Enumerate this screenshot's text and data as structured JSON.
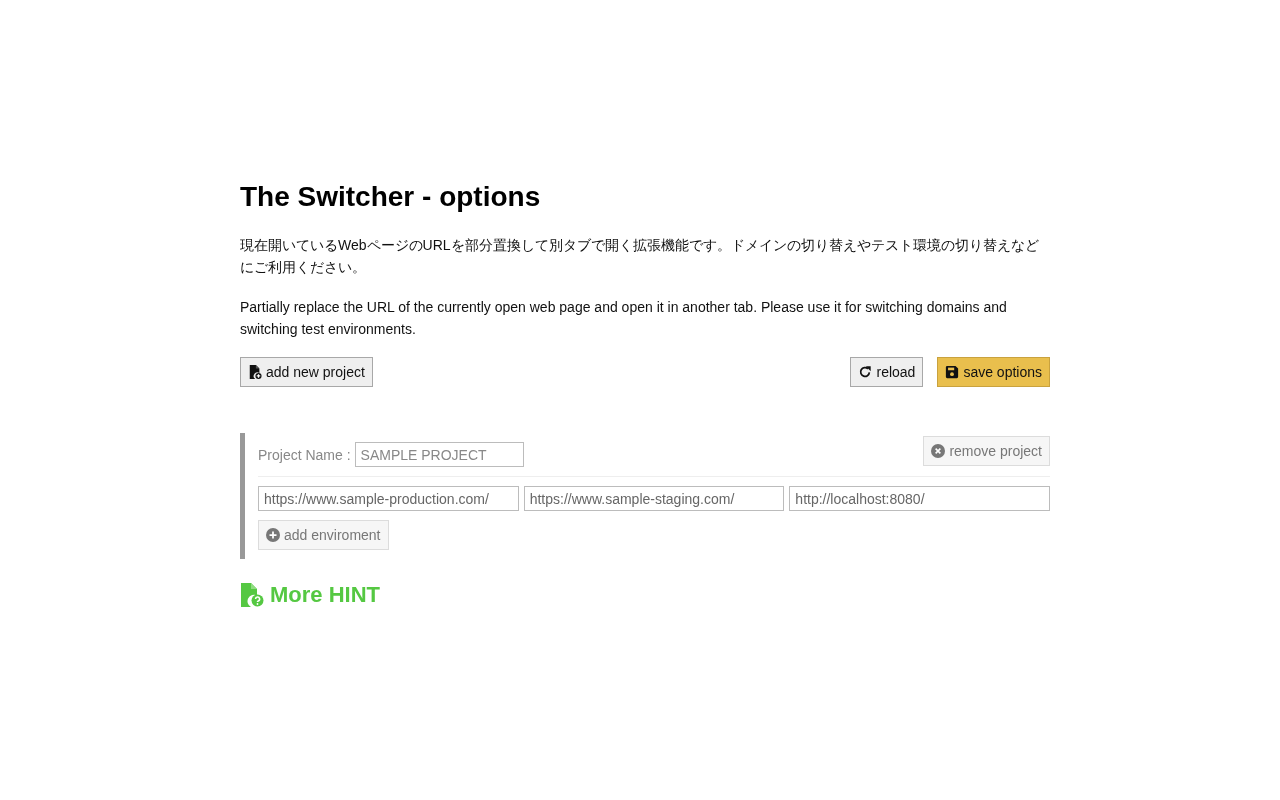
{
  "title": "The Switcher - options",
  "description_ja": "現在開いているWebページのURLを部分置換して別タブで開く拡張機能です。ドメインの切り替えやテスト環境の切り替えなどにご利用ください。",
  "description_en": "Partially replace the URL of the currently open web page and open it in another tab. Please use it for switching domains and switching test environments.",
  "toolbar": {
    "left": [
      {
        "kind": "add",
        "label": "add new project"
      }
    ],
    "right": [
      {
        "kind": "reload",
        "label": "reload"
      },
      {
        "kind": "save",
        "label": "save options"
      }
    ]
  },
  "projects": [
    {
      "name_label": "Project Name :",
      "name": "SAMPLE PROJECT",
      "remove_button": "remove project",
      "environments": [
        "https://www.sample-production.com/",
        "https://www.sample-staging.com/",
        "http://localhost:8080/"
      ],
      "add_environment_button": "add enviroment"
    }
  ],
  "hint_link": "More HINT"
}
